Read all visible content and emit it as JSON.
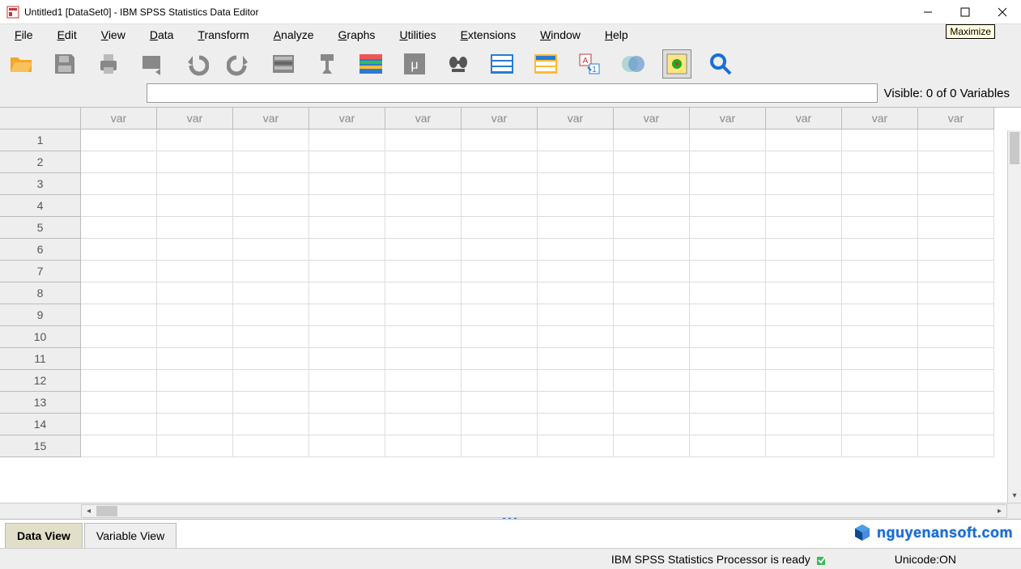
{
  "window": {
    "title": "Untitled1 [DataSet0] - IBM SPSS Statistics Data Editor",
    "tooltip_maximize": "Maximize"
  },
  "menu": {
    "items": [
      "File",
      "Edit",
      "View",
      "Data",
      "Transform",
      "Analyze",
      "Graphs",
      "Utilities",
      "Extensions",
      "Window",
      "Help"
    ]
  },
  "toolbar": {
    "icons": [
      "open",
      "save",
      "print",
      "recall",
      "undo",
      "redo",
      "goto-case",
      "goto-variable",
      "variables",
      "compute",
      "find",
      "split-file",
      "weight",
      "select-cases",
      "value-labels",
      "use-sets",
      "search"
    ]
  },
  "entry": {
    "value": "",
    "visible_text": "Visible: 0 of 0 Variables"
  },
  "grid": {
    "col_header": "var",
    "num_cols": 12,
    "num_rows": 15
  },
  "tabs": {
    "data_view": "Data View",
    "variable_view": "Variable View"
  },
  "status": {
    "processor": "IBM SPSS Statistics Processor is ready",
    "unicode": "Unicode:ON"
  },
  "watermark": "nguyenansoft.com"
}
